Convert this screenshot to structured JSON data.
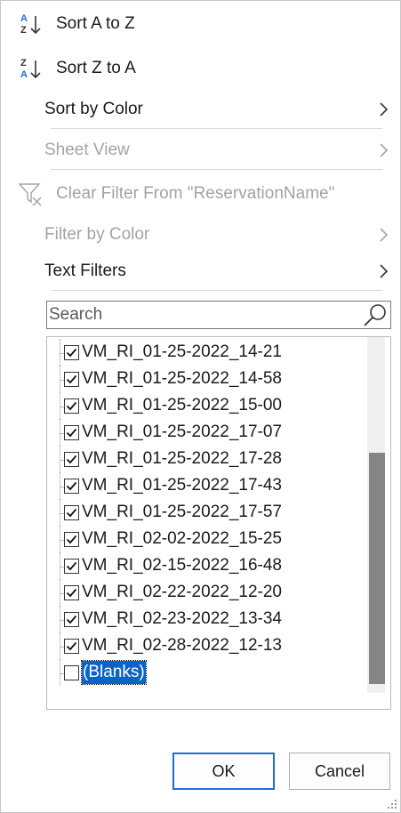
{
  "menu": {
    "sort_az": "Sort A to Z",
    "sort_za": "Sort Z to A",
    "sort_by_color": "Sort by Color",
    "sheet_view": "Sheet View",
    "clear_filter": "Clear Filter From \"ReservationName\"",
    "filter_by_color": "Filter by Color",
    "text_filters": "Text Filters",
    "sort_az_icon": "sort-ascending-icon",
    "sort_za_icon": "sort-descending-icon",
    "clear_filter_icon": "clear-filter-icon",
    "submenu_icon": "chevron-right-icon"
  },
  "search": {
    "placeholder": "Search",
    "value": "",
    "icon": "search-icon"
  },
  "list": {
    "items": [
      {
        "label": "VM_RI_01-25-2022_14-21",
        "checked": true
      },
      {
        "label": "VM_RI_01-25-2022_14-58",
        "checked": true
      },
      {
        "label": "VM_RI_01-25-2022_15-00",
        "checked": true
      },
      {
        "label": "VM_RI_01-25-2022_17-07",
        "checked": true
      },
      {
        "label": "VM_RI_01-25-2022_17-28",
        "checked": true
      },
      {
        "label": "VM_RI_01-25-2022_17-43",
        "checked": true
      },
      {
        "label": "VM_RI_01-25-2022_17-57",
        "checked": true
      },
      {
        "label": "VM_RI_02-02-2022_15-25",
        "checked": true
      },
      {
        "label": "VM_RI_02-15-2022_16-48",
        "checked": true
      },
      {
        "label": "VM_RI_02-22-2022_12-20",
        "checked": true
      },
      {
        "label": "VM_RI_02-23-2022_13-34",
        "checked": true
      },
      {
        "label": "VM_RI_02-28-2022_12-13",
        "checked": true
      },
      {
        "label": "(Blanks)",
        "checked": false,
        "selected": true
      }
    ]
  },
  "buttons": {
    "ok": "OK",
    "cancel": "Cancel"
  },
  "colors": {
    "selection": "#0a64c9",
    "ok_border": "#1f6fd1",
    "sort_icon_blue": "#1e6fd9",
    "disabled_text": "#a3a3a3"
  }
}
